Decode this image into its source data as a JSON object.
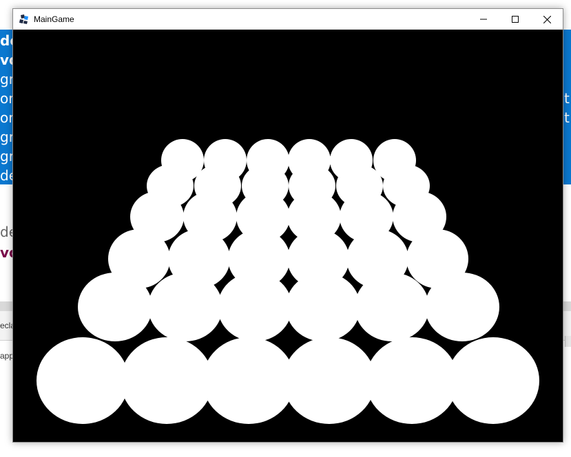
{
  "window": {
    "title": "MainGame",
    "icon": "game-controller-icon",
    "controls": {
      "minimize": "minimize-icon",
      "maximize": "maximize-icon",
      "close": "close-icon"
    }
  },
  "background_editor": {
    "selected_lines": [
      "de",
      "vo",
      "gr",
      "or",
      "or",
      "gr",
      "gr",
      "de"
    ],
    "right_glyphs": [
      "t",
      "t"
    ],
    "lines_below": [
      "de",
      "vo"
    ],
    "tab_text": "ecla",
    "panel_text": "app",
    "selection_color": "#0a78d0"
  },
  "game": {
    "background_color": "#000000",
    "ball_color": "#ffffff",
    "rows": 6,
    "balls_per_row": 6
  }
}
